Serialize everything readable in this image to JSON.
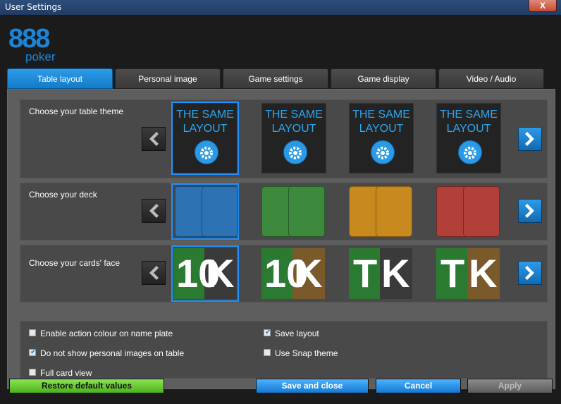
{
  "window": {
    "title": "User Settings",
    "close_label": "X"
  },
  "logo": {
    "number": "888",
    "subtitle": "poker"
  },
  "tabs": [
    "Table layout",
    "Personal image",
    "Game settings",
    "Game display",
    "Video / Audio"
  ],
  "active_tab": "Table layout",
  "sections": {
    "theme": {
      "label": "Choose your table theme",
      "option_text": "THE SAME LAYOUT",
      "selected_index": 0
    },
    "deck": {
      "label": "Choose your deck",
      "colors": [
        "#2d73b4",
        "#3d8a3e",
        "#c88a1e",
        "#b1403a"
      ],
      "selected_index": 0
    },
    "face": {
      "label": "Choose your cards' face",
      "options": [
        {
          "left": "10",
          "right": "K",
          "colors": [
            "#2b7a31",
            "#3a3a3a"
          ]
        },
        {
          "left": "10",
          "right": "K",
          "colors": [
            "#2b7a31",
            "#7a5a2a"
          ]
        },
        {
          "left": "T",
          "right": "K",
          "colors": [
            "#2b7a31",
            "#3a3a3a"
          ]
        },
        {
          "left": "T",
          "right": "K",
          "colors": [
            "#2b7a31",
            "#7a5a2a"
          ]
        }
      ],
      "selected_index": 0
    }
  },
  "checkboxes": [
    {
      "label": "Enable action colour on name plate",
      "checked": false
    },
    {
      "label": "Do not show personal images on table",
      "checked": true
    },
    {
      "label": "Full card view",
      "checked": false
    },
    {
      "label": "Save layout",
      "checked": true
    },
    {
      "label": "Use Snap theme",
      "checked": false
    }
  ],
  "buttons": {
    "restore": "Restore default values",
    "save_close": "Save and close",
    "cancel": "Cancel",
    "apply": "Apply"
  },
  "colors": {
    "accent": "#1c84d6",
    "restore": "#59c023",
    "disabled": "#6e6e6e"
  }
}
